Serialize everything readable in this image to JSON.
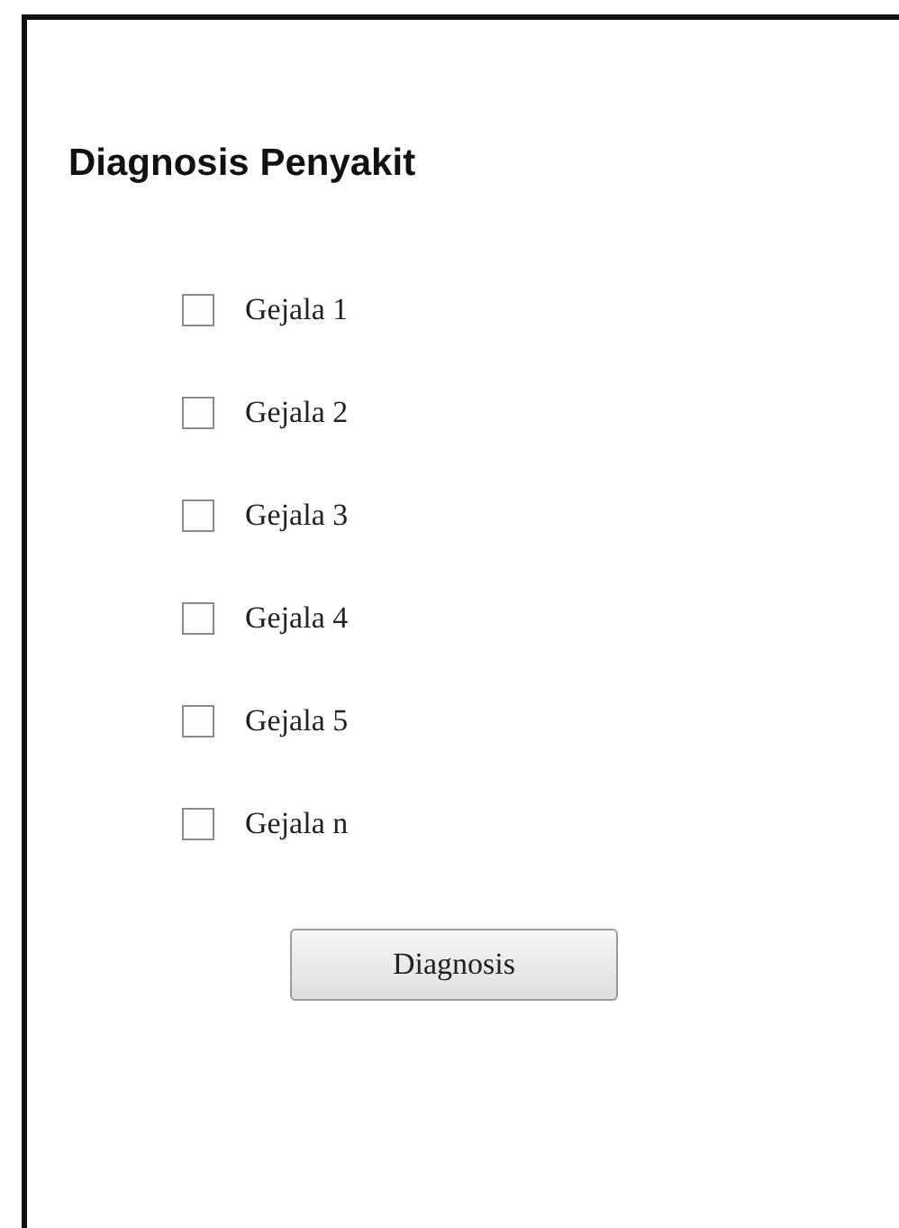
{
  "title": "Diagnosis Penyakit",
  "symptoms": [
    {
      "label": "Gejala 1",
      "checked": false
    },
    {
      "label": "Gejala 2",
      "checked": false
    },
    {
      "label": "Gejala 3",
      "checked": false
    },
    {
      "label": "Gejala 4",
      "checked": false
    },
    {
      "label": "Gejala 5",
      "checked": false
    },
    {
      "label": "Gejala n",
      "checked": false
    }
  ],
  "button": "Diagnosis"
}
